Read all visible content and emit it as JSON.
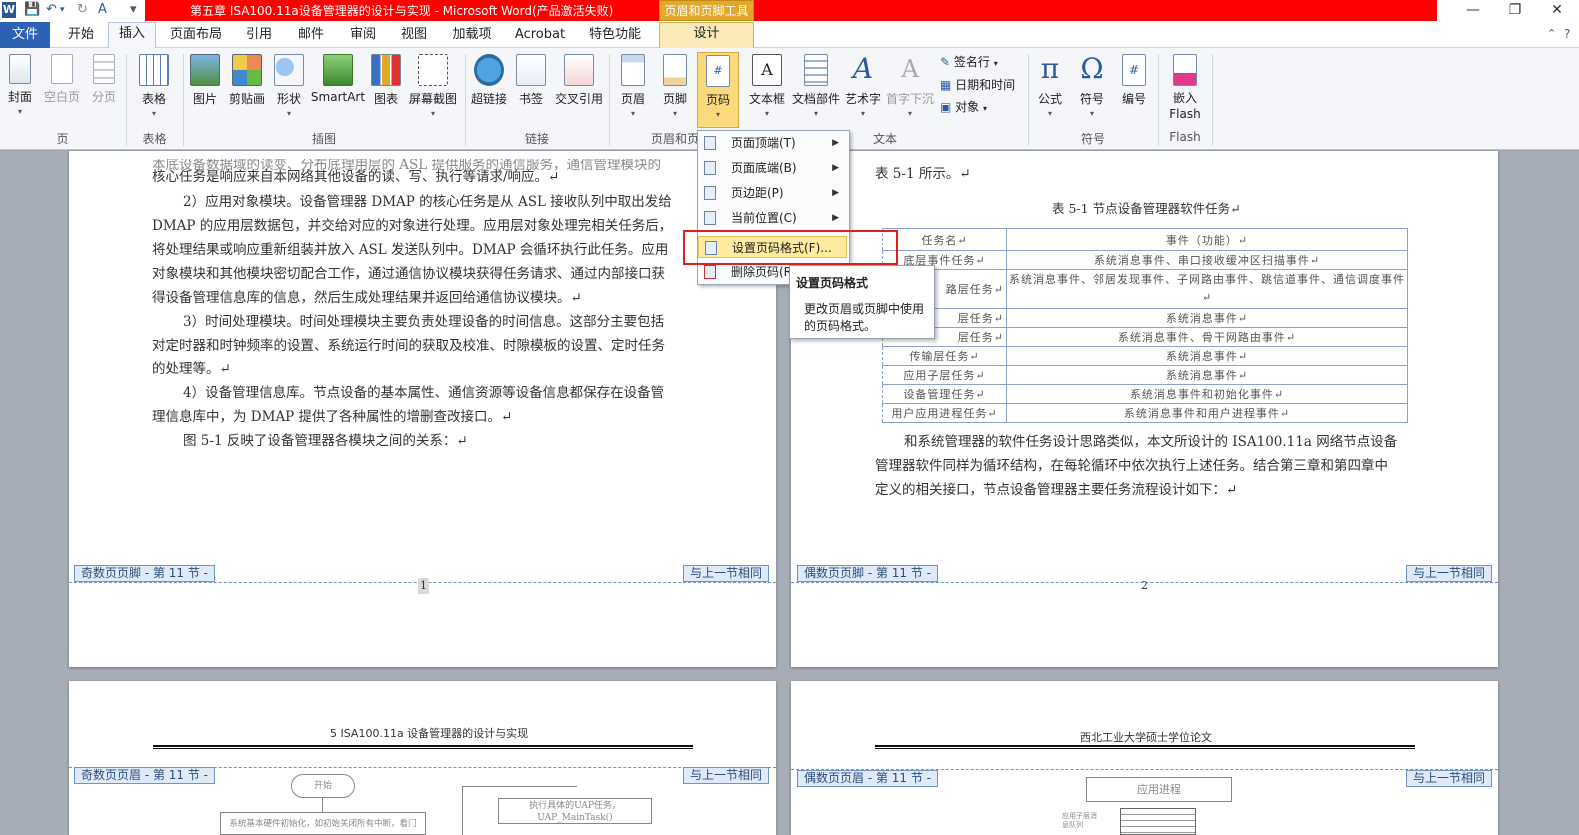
{
  "window": {
    "title": "第五章 ISA100.11a设备管理器的设计与实现 - Microsoft Word(产品激活失败)",
    "context_tab_group": "页眉和页脚工具"
  },
  "tabs": [
    "文件",
    "开始",
    "插入",
    "页面布局",
    "引用",
    "邮件",
    "审阅",
    "视图",
    "加载项",
    "Acrobat",
    "特色功能",
    "设计"
  ],
  "ribbon": {
    "pages_group": {
      "label": "页",
      "buttons": [
        "封面",
        "空白页",
        "分页"
      ]
    },
    "tables_group": {
      "label": "表格",
      "buttons": [
        "表格"
      ]
    },
    "illustrations_group": {
      "label": "插图",
      "buttons": [
        "图片",
        "剪贴画",
        "形状",
        "SmartArt",
        "图表",
        "屏幕截图"
      ]
    },
    "links_group": {
      "label": "链接",
      "buttons": [
        "超链接",
        "书签",
        "交叉引用"
      ]
    },
    "header_footer_group": {
      "label": "页眉和页",
      "buttons": [
        "页眉",
        "页脚",
        "页码"
      ]
    },
    "text_group": {
      "label": "文本",
      "buttons": [
        "文本框",
        "文档部件",
        "艺术字",
        "首字下沉"
      ],
      "small": [
        "签名行",
        "日期和时间",
        "对象"
      ]
    },
    "symbols_group": {
      "label": "符号",
      "buttons": [
        "公式",
        "符号",
        "编号"
      ]
    },
    "flash_group": {
      "label": "Flash",
      "buttons": [
        "嵌入 Flash"
      ]
    }
  },
  "page_number_menu": {
    "items": [
      "页面顶端(T)",
      "页面底端(B)",
      "页边距(P)",
      "当前位置(C)",
      "设置页码格式(F)...",
      "删除页码(R)"
    ]
  },
  "tooltip": {
    "title": "设置页码格式",
    "body": "更改页眉或页脚中使用的页码格式。"
  },
  "page1": {
    "lines": [
      "核心任务是响应来自本网络其他设备的读、写、执行等请求/响应。↵",
      "2）应用对象模块。设备管理器 DMAP 的核心任务是从 ASL 接收队列中取出发给",
      "DMAP 的应用层数据包，并交给对应的对象进行处理。应用层对象处理完相关任务后，",
      "将处理结果或响应重新组装并放入 ASL 发送队列中。DMAP 会循环执行此任务。应用",
      "对象模块和其他模块密切配合工作，通过通信协议模块获得任务请求、通过内部接口获",
      "得设备管理信息库的信息，然后生成处理结果并返回给通信协议模块。↵",
      "3）时间处理模块。时间处理模块主要负责处理设备的时间信息。这部分主要包括",
      "对定时器和时钟频率的设置、系统运行时间的获取及校准、时隙模板的设置、定时任务",
      "的处理等。↵",
      "4）设备管理信息库。节点设备的基本属性、通信资源等设备信息都保存在设备管",
      "理信息库中，为 DMAP 提供了各种属性的增删查改接口。↵",
      "图 5-1 反映了设备管理器各模块之间的关系：↵"
    ],
    "footer_label": "奇数页页脚 - 第 11 节 -",
    "same_as_prev": "与上一节相同",
    "page_number": "1"
  },
  "page2": {
    "intro": "表 5-1 所示。↵",
    "table_caption": "表 5-1  节点设备管理器软件任务↵",
    "table_header": [
      "任务名↵",
      "事件（功能）↵"
    ],
    "table_rows": [
      [
        "底层事件任务↵",
        "系统消息事件、串口接收缓冲区扫描事件↵"
      ],
      [
        "路层任务↵",
        "系统消息事件、邻居发现事件、子网路由事件、跳信道事件、通信调度事件↵"
      ],
      [
        "层任务↵",
        "系统消息事件↵"
      ],
      [
        "层任务↵",
        "系统消息事件、骨干网路由事件↵"
      ],
      [
        "传输层任务↵",
        "系统消息事件↵"
      ],
      [
        "应用子层任务↵",
        "系统消息事件↵"
      ],
      [
        "设备管理任务↵",
        "系统消息事件和初始化事件↵"
      ],
      [
        "用户应用进程任务↵",
        "系统消息事件和用户进程事件↵"
      ]
    ],
    "para": [
      "和系统管理器的软件任务设计思路类似，本文所设计的  ISA100.11a  网络节点设备",
      "管理器软件同样为循环结构，在每轮循环中依次执行上述任务。结合第三章和第四章中",
      "定义的相关接口，节点设备管理器主要任务流程设计如下：↵"
    ],
    "footer_label": "偶数页页脚 - 第 11 节 -",
    "same_as_prev": "与上一节相同",
    "page_number": "2"
  },
  "page3": {
    "header_text": "5 ISA100.11a 设备管理器的设计与实现",
    "header_label": "奇数页页眉 - 第 11 节 -",
    "same_as_prev": "与上一节相同",
    "flow": [
      "开始",
      "系统基本硬件初始化，如初始关闭所有中断，看门",
      "执行具体的UAP任务，",
      "UAP_MainTask()"
    ]
  },
  "page4": {
    "header_text": "西北工业大学硕士学位论文",
    "header_label": "偶数页页眉 - 第 11 节 -",
    "same_as_prev": "与上一节相同",
    "flow": [
      "应用进程",
      "应用子层消息队列"
    ]
  }
}
